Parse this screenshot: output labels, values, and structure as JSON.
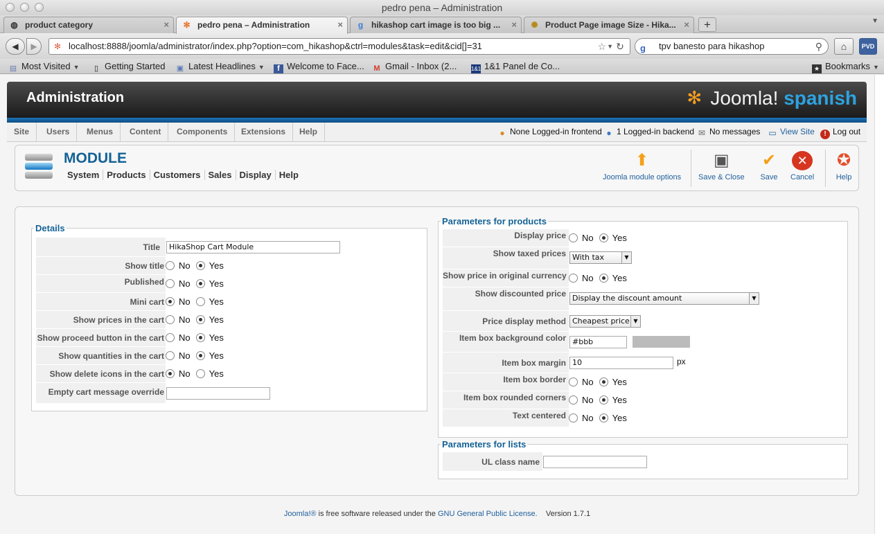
{
  "window": {
    "title": "pedro pena – Administration"
  },
  "tabs": [
    {
      "label": "product category"
    },
    {
      "label": "pedro pena – Administration"
    },
    {
      "label": "hikashop cart image is too big ..."
    },
    {
      "label": "Product Page image Size - Hika..."
    }
  ],
  "nav": {
    "url": "localhost:8888/joomla/administrator/index.php?option=com_hikashop&ctrl=modules&task=edit&cid[]=31",
    "search_value": "tpv banesto para hikashop",
    "search_engine_icon": "g"
  },
  "bookmarks": [
    {
      "label": "Most Visited",
      "icon": "folder-icon"
    },
    {
      "label": "Getting Started",
      "icon": "page-icon"
    },
    {
      "label": "Latest Headlines",
      "icon": "rss-icon"
    },
    {
      "label": "Welcome to Face...",
      "icon": "facebook-icon"
    },
    {
      "label": "Gmail - Inbox (2...",
      "icon": "gmail-icon"
    },
    {
      "label": "1&1 Panel de Co...",
      "icon": "oneandone-icon"
    },
    {
      "label": "Bookmarks",
      "icon": "bookmarks-icon"
    }
  ],
  "header": {
    "title": "Administration",
    "logo_text": "Joomla!",
    "logo_suffix": "spanish"
  },
  "menu": [
    "Site",
    "Users",
    "Menus",
    "Content",
    "Components",
    "Extensions",
    "Help"
  ],
  "status": {
    "frontend": "None Logged-in frontend",
    "backend": "1 Logged-in backend",
    "messages": "No messages",
    "view_site": "View Site",
    "logout": "Log out"
  },
  "module": {
    "title": "MODULE",
    "submenu": [
      "System",
      "Products",
      "Customers",
      "Sales",
      "Display",
      "Help"
    ],
    "toolbar": {
      "options": "Joomla module options",
      "save_close": "Save & Close",
      "save": "Save",
      "cancel": "Cancel",
      "help": "Help"
    }
  },
  "radio_labels": {
    "no": "No",
    "yes": "Yes"
  },
  "details": {
    "legend": "Details",
    "title_label": "Title",
    "title_value": "HikaShop Cart Module",
    "rows": [
      {
        "label": "Show title",
        "value": "yes"
      },
      {
        "label": "Published",
        "value": "yes"
      },
      {
        "label": "Mini cart",
        "value": "no"
      },
      {
        "label": "Show prices in the cart",
        "value": "yes"
      },
      {
        "label": "Show proceed button in the cart",
        "value": "yes"
      },
      {
        "label": "Show quantities in the cart",
        "value": "yes"
      },
      {
        "label": "Show delete icons in the cart",
        "value": "no"
      }
    ],
    "empty_label": "Empty cart message override",
    "empty_value": ""
  },
  "products": {
    "legend": "Parameters for products",
    "display_price_label": "Display price",
    "display_price": "yes",
    "taxed_label": "Show taxed prices",
    "taxed_value": "With tax",
    "orig_currency_label": "Show price in original currency",
    "orig_currency": "yes",
    "discount_label": "Show discounted price",
    "discount_value": "Display the discount amount",
    "method_label": "Price display method",
    "method_value": "Cheapest price",
    "bg_label": "Item box background color",
    "bg_value": "#bbb",
    "bg_swatch": "#bbbbbb",
    "margin_label": "Item box margin",
    "margin_value": "10",
    "margin_unit": "px",
    "border_label": "Item box border",
    "border": "yes",
    "rounded_label": "Item box rounded corners",
    "rounded": "yes",
    "centered_label": "Text centered",
    "centered": "yes"
  },
  "lists": {
    "legend": "Parameters for lists",
    "ul_label": "UL class name",
    "ul_value": ""
  },
  "footer": {
    "joomla": "Joomla!®",
    "text": "is free software released under the",
    "license": "GNU General Public License.",
    "version": "Version 1.7.1"
  }
}
